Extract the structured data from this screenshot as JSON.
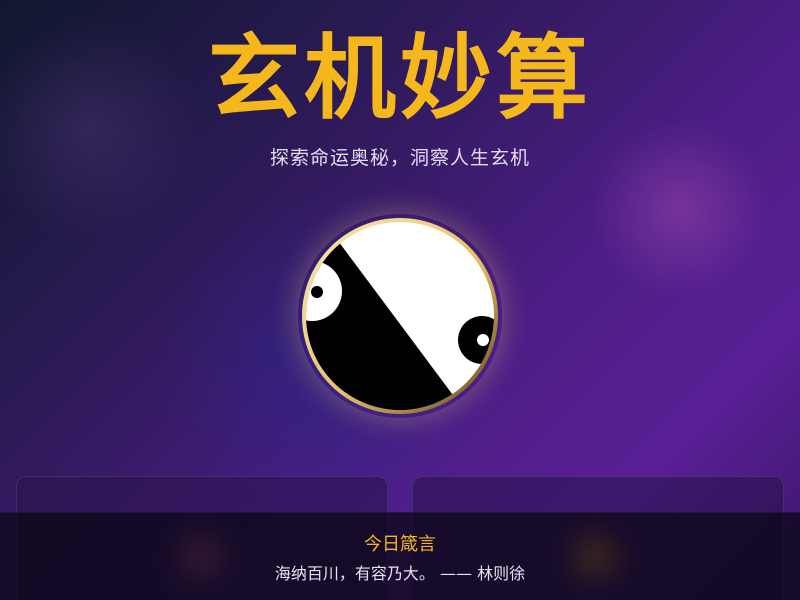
{
  "header": {
    "title": "玄机妙算",
    "subtitle": "探索命运奥秘，洞察人生玄机"
  },
  "taiji": {
    "icon": "yin-yang-icon",
    "colors": {
      "light": "#ffffff",
      "dark": "#000000",
      "rim_light": "#fde9b0",
      "rim_dark": "#5a4410"
    }
  },
  "daily_quote": {
    "label": "今日箴言",
    "text": "海纳百川，有容乃大。 —— 林则徐"
  },
  "colors": {
    "accent": "#f4b81c",
    "background_start": "#10182e",
    "background_end": "#5a1f95"
  }
}
